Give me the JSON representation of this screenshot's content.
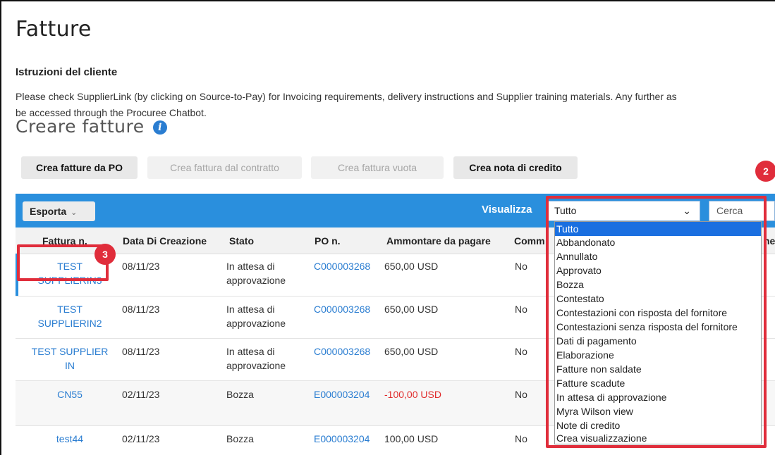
{
  "page": {
    "title": "Fatture",
    "instructions_title": "Istruzioni del cliente",
    "instructions_line1": "Please check SupplierLink (by clicking on Source-to-Pay) for Invoicing requirements, delivery instructions and Supplier training materials. Any further as",
    "instructions_line2": "be accessed through the Procuree Chatbot.",
    "create_title": "Creare fatture",
    "info_icon_glyph": "i"
  },
  "buttons": {
    "create_from_po": "Crea fatture da PO",
    "create_from_contract": "Crea fattura dal contratto",
    "create_blank": "Crea fattura vuota",
    "create_credit_note": "Crea nota di credito"
  },
  "toolbar": {
    "export_label": "Esporta",
    "export_chevron": "⌄",
    "view_label": "Visualizza",
    "view_selected": "Tutto",
    "view_chevron": "⌄",
    "search_placeholder": "Cerca"
  },
  "table": {
    "headers": {
      "invoice": "Fattura n.",
      "date": "Data Di Creazione",
      "status": "Stato",
      "po": "PO n.",
      "amount": "Ammontare da pagare",
      "comm": "Comm",
      "trailing": "ne"
    },
    "rows": [
      {
        "invoice_1": "TEST",
        "invoice_2": "SUPPLIERIN3",
        "date": "08/11/23",
        "status_1": "In attesa di",
        "status_2": "approvazione",
        "po": "C000003268",
        "amount": "650,00 USD",
        "comm": "No"
      },
      {
        "invoice_1": "TEST",
        "invoice_2": "SUPPLIERIN2",
        "date": "08/11/23",
        "status_1": "In attesa di",
        "status_2": "approvazione",
        "po": "C000003268",
        "amount": "650,00 USD",
        "comm": "No"
      },
      {
        "invoice_1": "TEST SUPPLIER",
        "invoice_2": "IN",
        "date": "08/11/23",
        "status_1": "In attesa di",
        "status_2": "approvazione",
        "po": "C000003268",
        "amount": "650,00 USD",
        "comm": "No"
      },
      {
        "invoice_1": "CN55",
        "invoice_2": "",
        "date": "02/11/23",
        "status_1": "Bozza",
        "status_2": "",
        "po": "E000003204",
        "amount": "-100,00 USD",
        "comm": "No"
      },
      {
        "invoice_1": "test44",
        "invoice_2": "",
        "date": "02/11/23",
        "status_1": "Bozza",
        "status_2": "",
        "po": "E000003204",
        "amount": "100,00 USD",
        "comm": "No"
      }
    ]
  },
  "dropdown": {
    "options": [
      "Tutto",
      "Abbandonato",
      "Annullato",
      "Approvato",
      "Bozza",
      "Contestato",
      "Contestazioni con risposta del fornitore",
      "Contestazioni senza risposta del fornitore",
      "Dati di pagamento",
      "Elaborazione",
      "Fatture non saldate",
      "Fatture scadute",
      "In attesa di approvazione",
      "Myra Wilson view",
      "Note di credito",
      "Crea visualizzazione"
    ],
    "selected_index": 0
  },
  "callouts": {
    "two": "2",
    "three": "3"
  },
  "colors": {
    "accent": "#2a8fdd",
    "link": "#2a7dd1",
    "callout": "#e02d3b",
    "negative": "#e02b2b",
    "selected_option": "#1a6fe0"
  }
}
